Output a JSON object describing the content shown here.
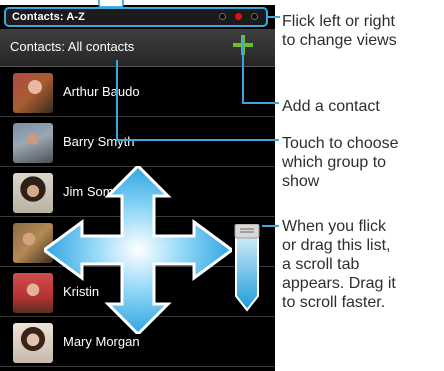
{
  "title_bar": {
    "text": "Contacts: A-Z"
  },
  "header": {
    "text": "Contacts: All contacts"
  },
  "contacts": [
    {
      "name": "Arthur Baudo"
    },
    {
      "name": "Barry Smyth"
    },
    {
      "name": "Jim Somers"
    },
    {
      "name": ""
    },
    {
      "name": "Kristin"
    },
    {
      "name": "Mary Morgan"
    }
  ],
  "callouts": {
    "flick": "Flick left or right\nto change views",
    "add": "Add a contact",
    "group": "Touch to choose\nwhich group to\nshow",
    "scroll": "When you flick\nor drag this list,\na scroll tab\nappears. Drag it\nto scroll faster."
  },
  "colors": {
    "accent": "#3aa8dd",
    "add": "#6fbd2c",
    "active_dot": "#e0101a"
  },
  "icons": {
    "add": "plus-icon",
    "arrows": "four-way-arrow-icon",
    "scroll": "scroll-tab-icon"
  }
}
